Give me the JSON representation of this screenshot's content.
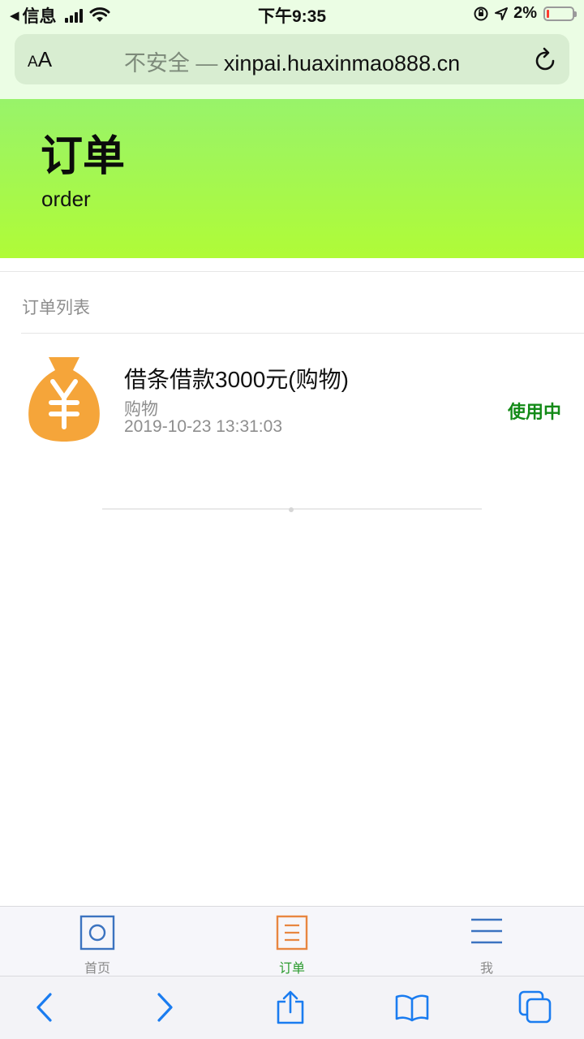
{
  "status_bar": {
    "back_app": "信息",
    "time": "下午9:35",
    "battery_percent": "2%",
    "battery_level": 0.02
  },
  "browser": {
    "text_size_label": "AA",
    "security_label": "不安全",
    "separator": "—",
    "domain": "xinpai.huaxinmao888.cn"
  },
  "header": {
    "title": "订单",
    "subtitle": "order"
  },
  "order_list": {
    "title": "订单列表",
    "items": [
      {
        "name": "借条借款3000元(购物)",
        "category": "购物",
        "time": "2019-10-23 13:31:03",
        "status": "使用中"
      }
    ]
  },
  "tab_bar": {
    "tabs": [
      {
        "label": "首页",
        "icon": "home-icon",
        "active": false
      },
      {
        "label": "订单",
        "icon": "document-icon",
        "active": true
      },
      {
        "label": "我",
        "icon": "menu-icon",
        "active": false
      }
    ]
  },
  "colors": {
    "header_gradient_top": "#98f36a",
    "header_gradient_bottom": "#b0fb37",
    "status_green": "#138a17",
    "tab_active": "#2b9a2e",
    "home_icon_blue": "#3b73c0",
    "order_icon_orange": "#e88640",
    "safari_blue": "#1a7cf0"
  }
}
